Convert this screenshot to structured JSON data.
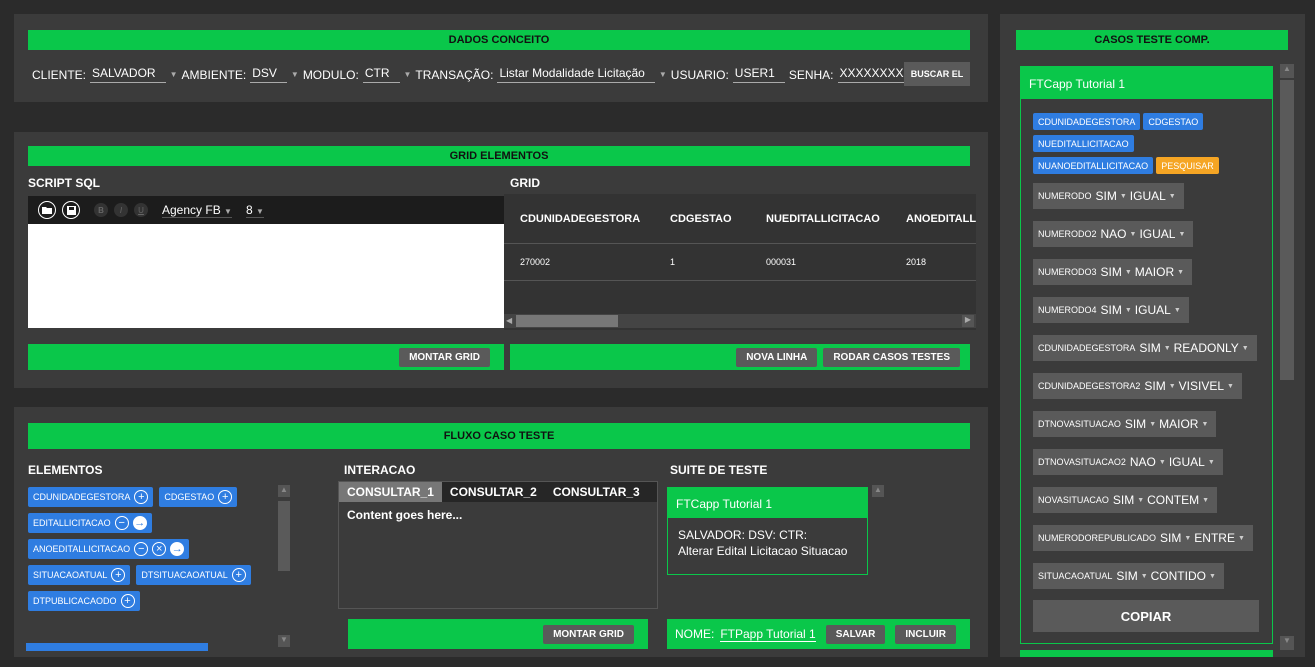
{
  "dados": {
    "title": "DADOS CONCEITO",
    "fields": [
      {
        "label": "CLIENTE:",
        "value": "SALVADOR",
        "dropdown": true
      },
      {
        "label": "AMBIENTE:",
        "value": "DSV",
        "dropdown": true
      },
      {
        "label": "MODULO:",
        "value": "CTR",
        "dropdown": true
      },
      {
        "label": "TRANSAÇÃO:",
        "value": "Listar Modalidade Licitação",
        "dropdown": true
      },
      {
        "label": "USUARIO:",
        "value": "USER1",
        "dropdown": false
      },
      {
        "label": "SENHA:",
        "value": "XXXXXXXXXXX",
        "dropdown": false
      }
    ],
    "buscar_label": "BUSCAR EL"
  },
  "grid_elementos": {
    "title": "GRID ELEMENTOS",
    "script_label": "SCRIPT SQL",
    "font_name": "Agency FB",
    "font_size": "8",
    "montar_label": "MONTAR GRID",
    "grid_label": "GRID",
    "columns": [
      "CDUNIDADEGESTORA",
      "CDGESTAO",
      "NUEDITALLICITACAO",
      "ANOEDITALLI"
    ],
    "rows": [
      [
        "270002",
        "1",
        "000031",
        "2018"
      ]
    ],
    "nova_linha_label": "NOVA LINHA",
    "rodar_label": "RODAR CASOS TESTES"
  },
  "fluxo": {
    "title": "FLUXO CASO TESTE",
    "elementos_label": "ELEMENTOS",
    "chip_rows": [
      [
        {
          "text": "CDUNIDADEGESTORA",
          "icons": [
            "+"
          ]
        },
        {
          "text": "CDGESTAO",
          "icons": [
            "+"
          ]
        }
      ],
      [
        {
          "text": "EDITALLICITACAO",
          "icons": [
            "−",
            "→"
          ]
        }
      ],
      [
        {
          "text": "ANOEDITALLICITACAO",
          "icons": [
            "−",
            "×",
            "→"
          ]
        }
      ],
      [
        {
          "text": "SITUACAOATUAL",
          "icons": [
            "+"
          ]
        },
        {
          "text": "DTSITUACAOATUAL",
          "icons": [
            "+"
          ]
        }
      ],
      [
        {
          "text": "DTPUBLICACAODO",
          "icons": [
            "+"
          ]
        }
      ]
    ],
    "interacao_label": "INTERACAO",
    "tabs": [
      "CONSULTAR_1",
      "CONSULTAR_2",
      "CONSULTAR_3"
    ],
    "tab_content": "Content goes here...",
    "montar_label": "MONTAR GRID",
    "suite_label": "SUITE DE TESTE",
    "suite_card_title": "FTCapp Tutorial 1",
    "suite_card_line1": "SALVADOR: DSV: CTR:",
    "suite_card_line2": "Alterar Edital Licitacao Situacao",
    "nome_label": "NOME:",
    "nome_value": "FTPapp Tutorial 1",
    "salvar_label": "SALVAR",
    "incluir_label": "INCLUIR"
  },
  "casos": {
    "title": "CASOS TESTE COMP.",
    "card_title": "FTCapp Tutorial 1",
    "chip_rows": [
      [
        {
          "text": "CDUNIDADEGESTORA",
          "color": "blue"
        },
        {
          "text": "CDGESTAO",
          "color": "blue"
        }
      ],
      [
        {
          "text": "NUEDITALLICITACAO",
          "color": "blue"
        }
      ],
      [
        {
          "text": "NUANOEDITALLICITACAO",
          "color": "blue"
        },
        {
          "text": "PESQUISAR",
          "color": "orange"
        }
      ]
    ],
    "conditions": [
      {
        "field": "NUMERODO",
        "flag": "SIM",
        "op": "IGUAL"
      },
      {
        "field": "NUMERODO2",
        "flag": "NAO",
        "op": "IGUAL"
      },
      {
        "field": "NUMERODO3",
        "flag": "SIM",
        "op": "MAIOR"
      },
      {
        "field": "NUMERODO4",
        "flag": "SIM",
        "op": "IGUAL"
      },
      {
        "field": "CDUNIDADEGESTORA",
        "flag": "SIM",
        "op": "READONLY"
      },
      {
        "field": "CDUNIDADEGESTORA2",
        "flag": "SIM",
        "op": "VISIVEL"
      },
      {
        "field": "DTNOVASITUACAO",
        "flag": "SIM",
        "op": "MAIOR"
      },
      {
        "field": "DTNOVASITUACAO2",
        "flag": "NAO",
        "op": "IGUAL"
      },
      {
        "field": "NOVASITUACAO",
        "flag": "SIM",
        "op": "CONTEM"
      },
      {
        "field": "NUMERODOREPUBLICADO",
        "flag": "SIM",
        "op": "ENTRE"
      },
      {
        "field": "SITUACAOATUAL",
        "flag": "SIM",
        "op": "CONTIDO"
      }
    ],
    "copiar_label": "COPIAR"
  },
  "colors": {
    "green": "#0ac74a",
    "blue": "#2f7de1",
    "orange": "#f5a524",
    "panel": "#3b3b3b",
    "dark_button": "#5a5a5a"
  }
}
